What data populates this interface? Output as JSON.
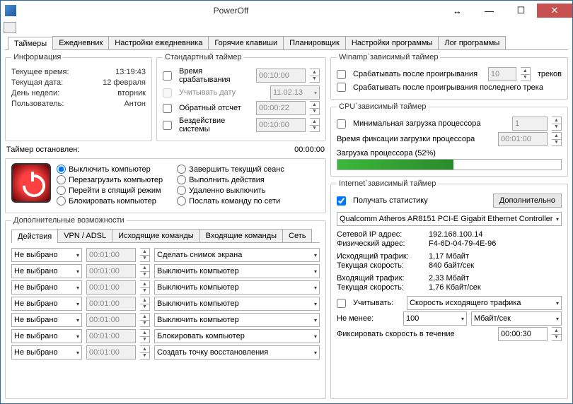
{
  "window": {
    "title": "PowerOff"
  },
  "tabs": [
    "Таймеры",
    "Ежедневник",
    "Настройки ежедневника",
    "Горячие клавиши",
    "Планировщик",
    "Настройки программы",
    "Лог программы"
  ],
  "info": {
    "legend": "Информация",
    "time_lbl": "Текущее время:",
    "time_val": "13:19:43",
    "date_lbl": "Текущая дата:",
    "date_val": "12 февраля",
    "dow_lbl": "День недели:",
    "dow_val": "вторник",
    "user_lbl": "Пользователь:",
    "user_val": "Антон",
    "stopped_lbl": "Таймер остановлен:",
    "stopped_val": "00:00:00"
  },
  "std_timer": {
    "legend": "Стандартный таймер",
    "trigger_lbl": "Время срабатывания",
    "trigger_val": "00:10:00",
    "date_lbl": "Учитывать дату",
    "date_val": "11.02.13",
    "countdown_lbl": "Обратный отсчет",
    "countdown_val": "00:00:22",
    "idle_lbl": "Бездействие системы",
    "idle_val": "00:10:00"
  },
  "power_actions": {
    "col1": [
      "Выключить компьютер",
      "Перезагрузить компьютер",
      "Перейти в спящий режим",
      "Блокировать компьютер"
    ],
    "col2": [
      "Завершить текущий сеанс",
      "Выполнить действия",
      "Удаленно выключить",
      "Послать команду по сети"
    ]
  },
  "additional": {
    "legend": "Дополнительные возможности",
    "subtabs": [
      "Действия",
      "VPN / ADSL",
      "Исходящие команды",
      "Входящие команды",
      "Сеть"
    ],
    "rows": [
      {
        "sel": "Не выбрано",
        "time": "00:01:00",
        "action": "Сделать снимок экрана"
      },
      {
        "sel": "Не выбрано",
        "time": "00:01:00",
        "action": "Выключить компьютер"
      },
      {
        "sel": "Не выбрано",
        "time": "00:01:00",
        "action": "Выключить компьютер"
      },
      {
        "sel": "Не выбрано",
        "time": "00:01:00",
        "action": "Выключить компьютер"
      },
      {
        "sel": "Не выбрано",
        "time": "00:01:00",
        "action": "Выключить компьютер"
      },
      {
        "sel": "Не выбрано",
        "time": "00:01:00",
        "action": "Блокировать компьютер"
      },
      {
        "sel": "Не выбрано",
        "time": "00:01:00",
        "action": "Создать точку восстановления"
      }
    ]
  },
  "winamp": {
    "legend": "Winamp`зависимый таймер",
    "after_play_lbl": "Срабатывать после проигрывания",
    "tracks_val": "10",
    "tracks_lbl": "треков",
    "after_last_lbl": "Срабатывать после проигрывания последнего трека"
  },
  "cpu": {
    "legend": "CPU`зависимый таймер",
    "min_load_lbl": "Минимальная загрузка процессора",
    "min_load_val": "1",
    "fix_time_lbl": "Время фиксации загрузки процессора",
    "fix_time_val": "00:01:00",
    "load_lbl": "Загрузка процессора (52%)",
    "load_pct": 52
  },
  "internet": {
    "legend": "Internet`зависимый таймер",
    "stats_lbl": "Получать статистику",
    "more_btn": "Дополнительно",
    "adapter": "Qualcomm Atheros AR8151 PCI-E Gigabit Ethernet Controller",
    "ip_lbl": "Сетевой IP адрес:",
    "ip_val": "192.168.100.14",
    "mac_lbl": "Физический адрес:",
    "mac_val": "F4-6D-04-79-4E-96",
    "out_lbl": "Исходящий трафик:",
    "out_val": "1,17 Мбайт",
    "out_spd_lbl": "Текущая скорость:",
    "out_spd_val": "840 байт/сек",
    "in_lbl": "Входящий трафик:",
    "in_val": "2,33 Мбайт",
    "in_spd_lbl": "Текущая скорость:",
    "in_spd_val": "1,76 Кбайт/сек",
    "consider_lbl": "Учитывать:",
    "consider_val": "Скорость исходящего трафика",
    "atleast_lbl": "Не менее:",
    "atleast_val": "100",
    "atleast_unit": "Мбайт/сек",
    "fix_lbl": "Фиксировать скорость в течение",
    "fix_val": "00:00:30"
  }
}
